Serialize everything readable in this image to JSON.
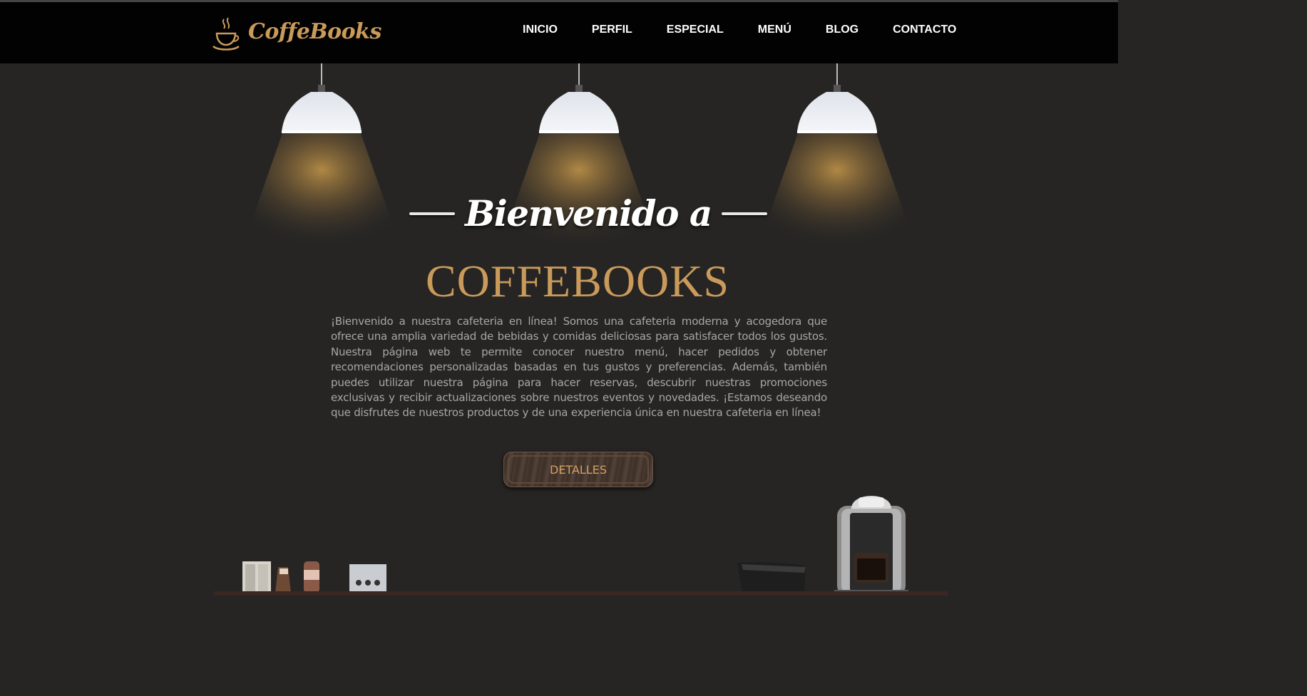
{
  "header": {
    "logo_text": "CoffeBooks",
    "logo_icon": "coffee-cup-icon",
    "nav": [
      "INICIO",
      "PERFIL",
      "ESPECIAL",
      "MENÚ",
      "BLOG",
      "CONTACTO"
    ]
  },
  "hero": {
    "welcome": "Bienvenido a",
    "brand": "COFFEBOOKS",
    "intro": "¡Bienvenido a nuestra cafeteria en línea! Somos una cafeteria moderna y acogedora que ofrece una amplia variedad de bebidas y comidas deliciosas para satisfacer todos los gustos. Nuestra página web te permite conocer nuestro menú, hacer pedidos y obtener recomendaciones personalizadas basadas en tus gustos y preferencias. Además, también puedes utilizar nuestra página para hacer reservas, descubrir nuestras promociones exclusivas y recibir actualizaciones sobre nuestros eventos y novedades. ¡Estamos deseando que disfrutes de nuestros productos y de una experiencia única en nuestra cafeteria en línea!",
    "button_label": "DETALLES"
  },
  "colors": {
    "accent": "#c99a5a",
    "background": "#262524",
    "navbar": "#020202"
  },
  "icons": [
    "coffee-cup-icon",
    "pendant-lamp-icon",
    "coffee-machine-icon"
  ]
}
